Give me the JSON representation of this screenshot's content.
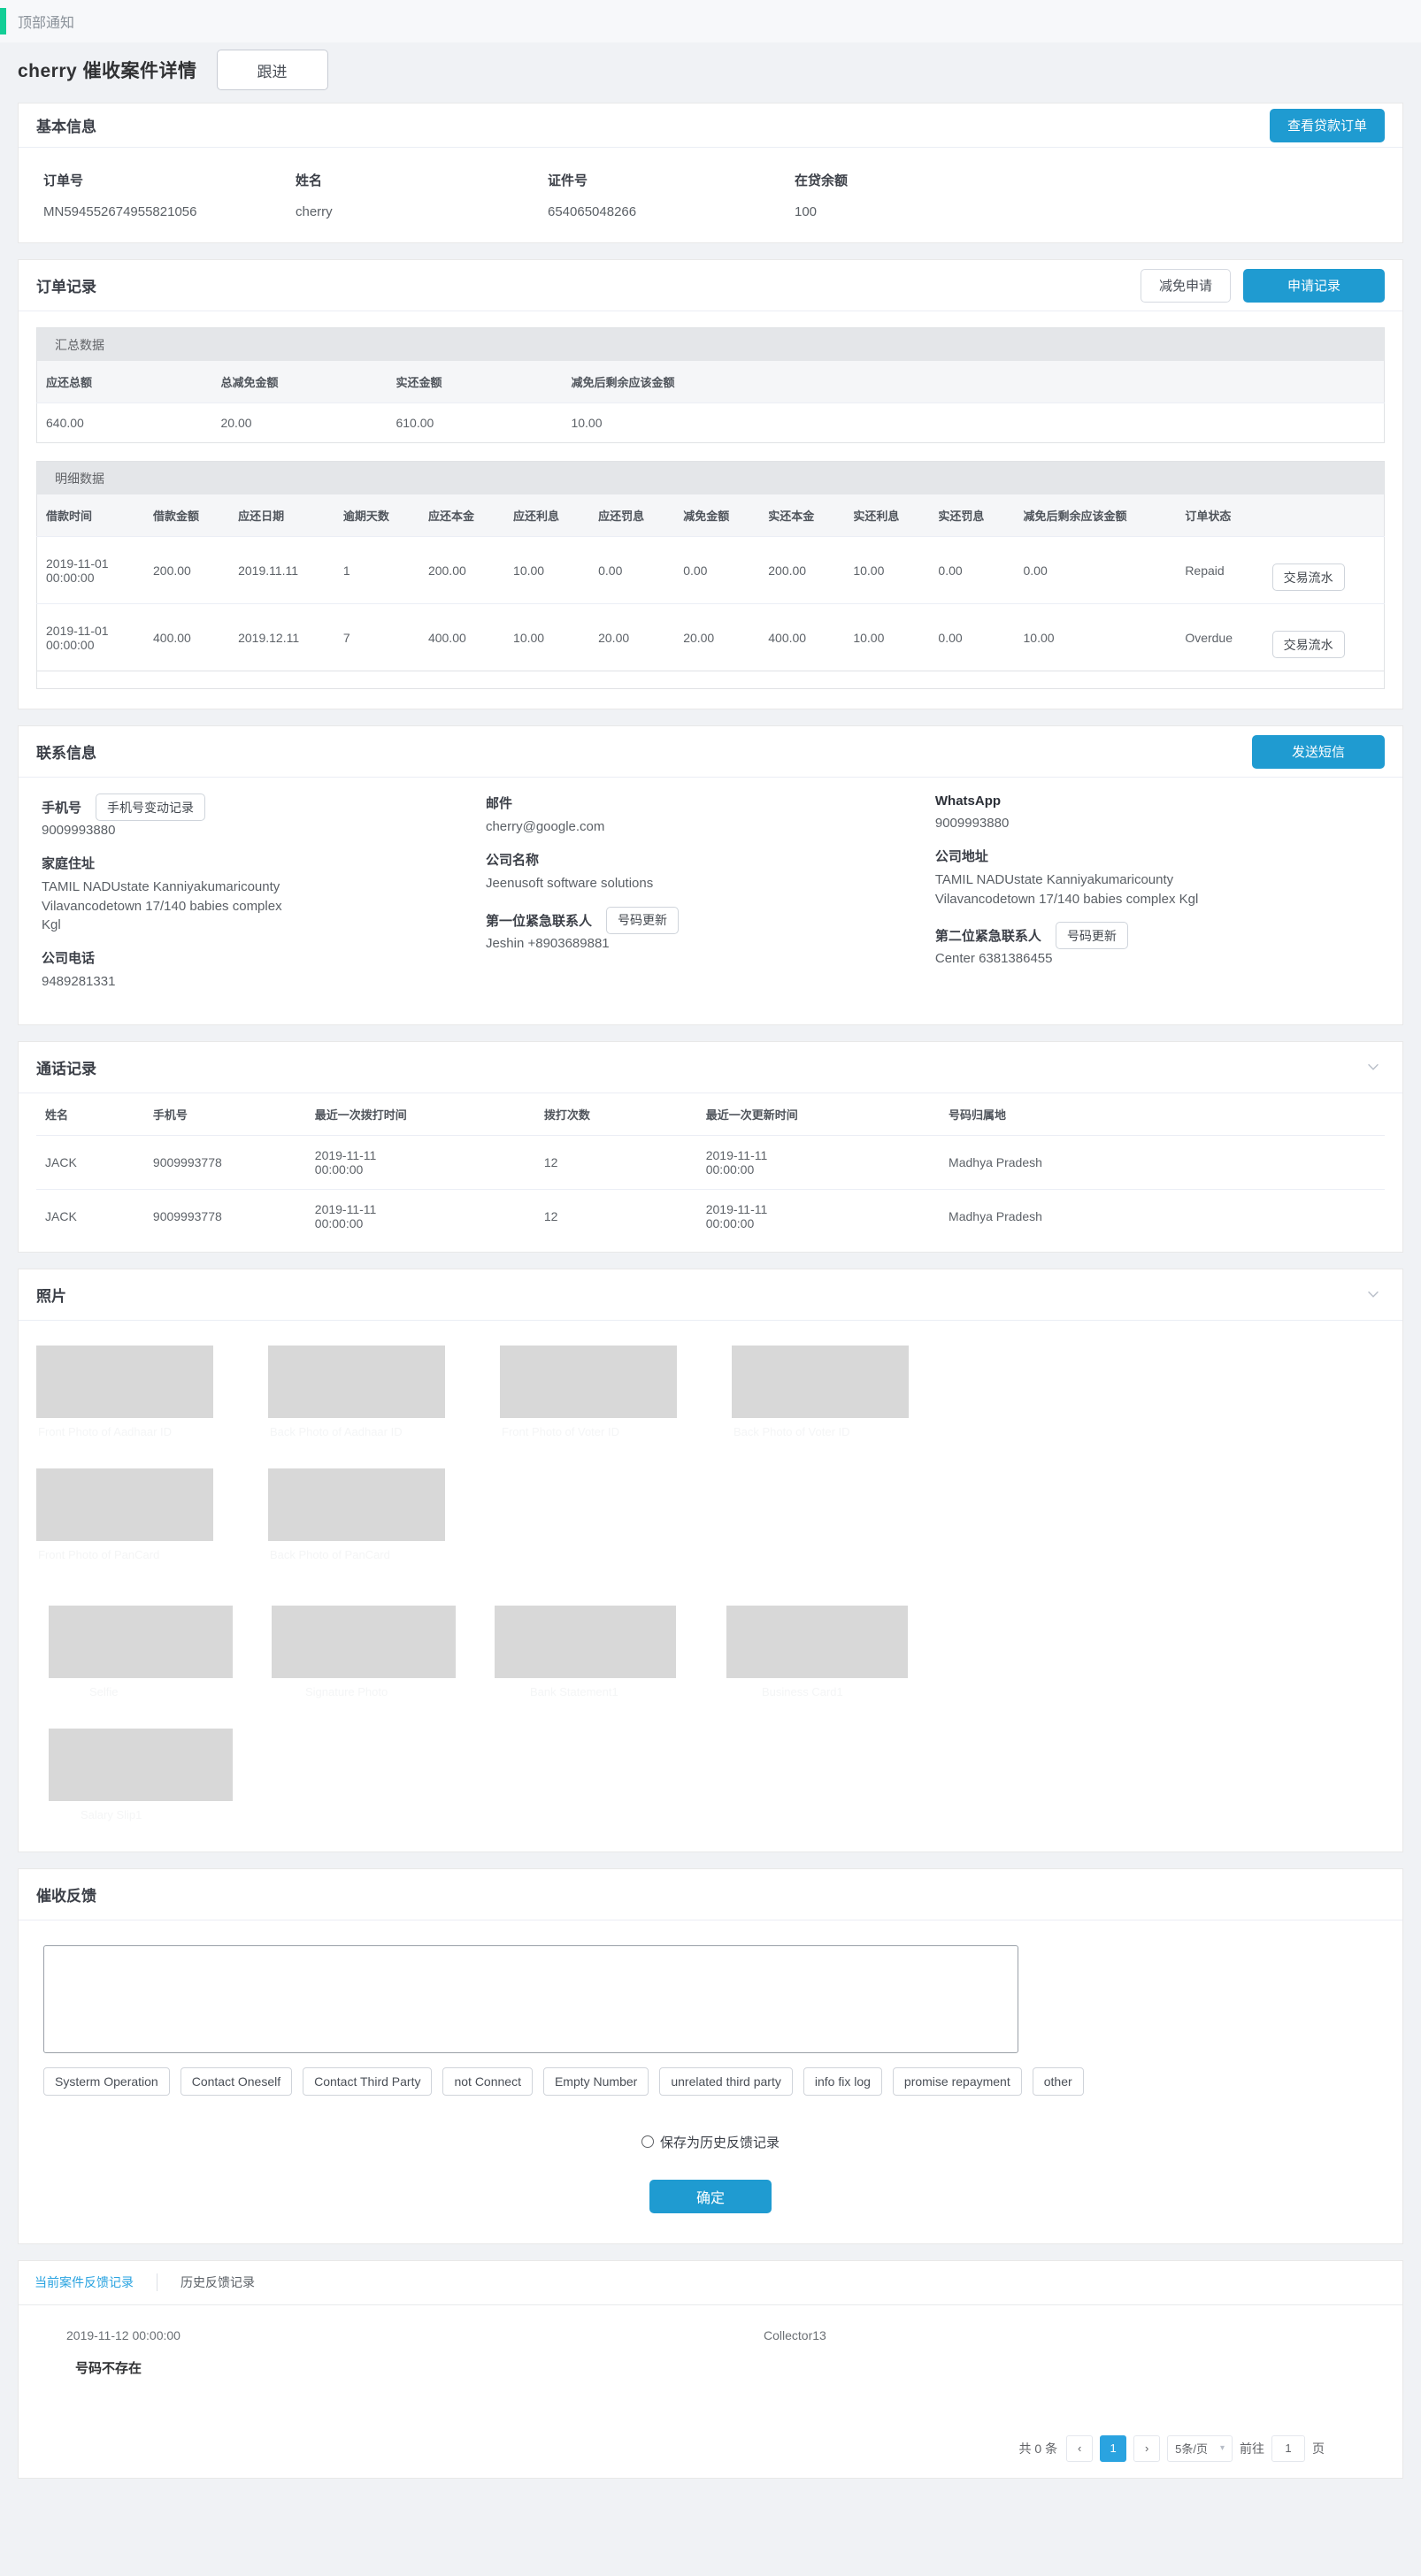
{
  "top_notice": {
    "text": "顶部通知",
    "bar_color": "#13ce96"
  },
  "header": {
    "title": "cherry 催收案件详情",
    "follow_button": "跟进"
  },
  "basic_info": {
    "title": "基本信息",
    "view_loan_button": "查看贷款订单",
    "fields": [
      {
        "label": "订单号",
        "value": "MN594552674955821056"
      },
      {
        "label": "姓名",
        "value": "cherry"
      },
      {
        "label": "证件号",
        "value": "654065048266"
      },
      {
        "label": "在贷余额",
        "value": "100"
      }
    ]
  },
  "order_record": {
    "title": "订单记录",
    "reduce_apply_button": "减免申请",
    "apply_record_button": "申请记录",
    "summary_band": "汇总数据",
    "summary_headers": [
      "应还总额",
      "总减免金额",
      "实还金额",
      "减免后剩余应该金额"
    ],
    "summary_row": [
      "640.00",
      "20.00",
      "610.00",
      "10.00"
    ],
    "detail_band": "明细数据",
    "detail_headers": [
      "借款时间",
      "借款金额",
      "应还日期",
      "逾期天数",
      "应还本金",
      "应还利息",
      "应还罚息",
      "减免金额",
      "实还本金",
      "实还利息",
      "实还罚息",
      "减免后剩余应该金额",
      "订单状态",
      ""
    ],
    "detail_rows": [
      {
        "cells": [
          "2019-11-01\n00:00:00",
          "200.00",
          "2019.11.11",
          "1",
          "200.00",
          "10.00",
          "0.00",
          "0.00",
          "200.00",
          "10.00",
          "0.00",
          "0.00",
          "Repaid"
        ],
        "action": "交易流水"
      },
      {
        "cells": [
          "2019-11-01\n00:00:00",
          "400.00",
          "2019.12.11",
          "7",
          "400.00",
          "10.00",
          "20.00",
          "20.00",
          "400.00",
          "10.00",
          "0.00",
          "10.00",
          "Overdue"
        ],
        "action": "交易流水"
      }
    ]
  },
  "contact_info": {
    "title": "联系信息",
    "send_sms_button": "发送短信",
    "col1": {
      "phone_label": "手机号",
      "phone_change_button": "手机号变动记录",
      "phone_value": "9009993880",
      "home_address_label": "家庭住址",
      "home_address_value": "TAMIL NADUstate Kanniyakumaricounty Vilavancodetown 17/140 babies complex Kgl",
      "company_phone_label": "公司电话",
      "company_phone_value": "9489281331"
    },
    "col2": {
      "email_label": "邮件",
      "email_value": "cherry@google.com",
      "company_name_label": "公司名称",
      "company_name_value": "Jeenusoft software solutions",
      "emergency1_label": "第一位紧急联系人",
      "emergency1_update_button": "号码更新",
      "emergency1_value": "Jeshin +8903689881"
    },
    "col3": {
      "whatsapp_label": "WhatsApp",
      "whatsapp_value": "9009993880",
      "company_address_label": "公司地址",
      "company_address_value": "TAMIL NADUstate Kanniyakumaricounty Vilavancodetown 17/140 babies complex Kgl",
      "emergency2_label": "第二位紧急联系人",
      "emergency2_update_button": "号码更新",
      "emergency2_value": "Center 6381386455"
    }
  },
  "call_records": {
    "title": "通话记录",
    "headers": [
      "姓名",
      "手机号",
      "最近一次拨打时间",
      "拨打次数",
      "最近一次更新时间",
      "号码归属地"
    ],
    "rows": [
      {
        "name": "JACK",
        "phone": "9009993778",
        "last_call": "2019-11-11\n00:00:00",
        "count": "12",
        "last_update": "2019-11-11\n00:00:00",
        "location": "Madhya Pradesh",
        "phone_is_link": true
      },
      {
        "name": "JACK",
        "phone": "9009993778",
        "last_call": "2019-11-11\n00:00:00",
        "count": "12",
        "last_update": "2019-11-11\n00:00:00",
        "location": "Madhya Pradesh",
        "phone_is_link": false
      }
    ]
  },
  "photos": {
    "title": "照片",
    "rows": [
      [
        "Front Photo of Aadhaar ID",
        "Back Photo of Aadhaar ID",
        "Front Photo of Voter ID",
        "Back Photo of Voter ID"
      ],
      [
        "Front Photo of PanCard",
        "Back Photo of PanCard"
      ],
      [
        "Selfie",
        "Signature Photo",
        "Bank Statement1",
        "Business Card1"
      ],
      [
        "Salary Slip1"
      ]
    ]
  },
  "feedback": {
    "title": "催收反馈",
    "textarea_value": "",
    "textarea_placeholder": "",
    "tags": [
      "Systerm Operation",
      "Contact Oneself",
      "Contact Third Party",
      "not Connect",
      "Empty Number",
      "unrelated third party",
      "info fix log",
      "promise repayment",
      "other"
    ],
    "save_history_label": "保存为历史反馈记录",
    "confirm_button": "确定"
  },
  "feedback_records": {
    "tabs": [
      {
        "label": "当前案件反馈记录",
        "active": true
      },
      {
        "label": "历史反馈记录",
        "active": false
      }
    ],
    "record": {
      "date": "2019-11-12  00:00:00",
      "user": "Collector13",
      "content": "号码不存在"
    },
    "pagination": {
      "total_text": "共 0 条",
      "prev": "‹",
      "pages": [
        "1"
      ],
      "current_page": "1",
      "next": "›",
      "page_size": "5条/页",
      "jump_prefix": "前往",
      "jump_value": "1",
      "jump_suffix": "页"
    }
  },
  "colors": {
    "accent": "#1f9bd1",
    "link": "#3aa5e8",
    "notice_bar": "#13ce96"
  }
}
